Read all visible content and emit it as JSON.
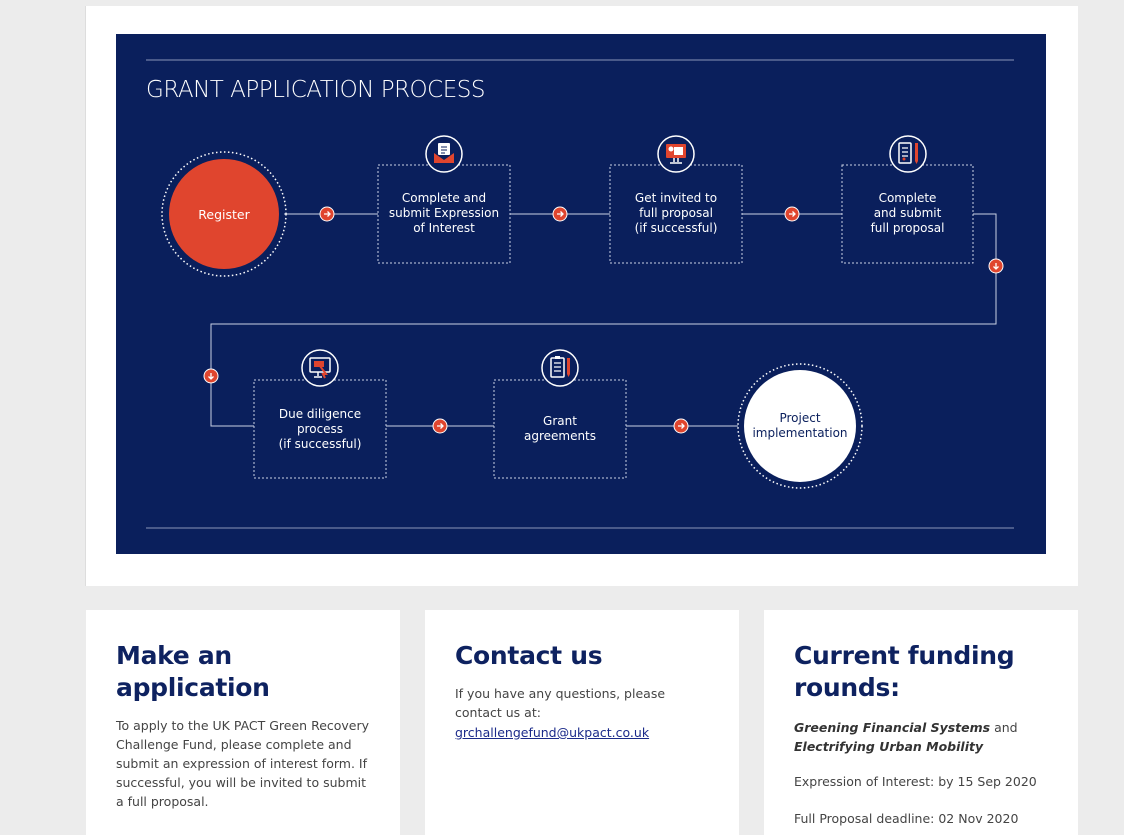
{
  "diagram": {
    "title": "GRANT APPLICATION PROCESS",
    "colors": {
      "background": "#0a1f5c",
      "accent": "#e0452e"
    },
    "steps": {
      "register": "Register",
      "eoi": [
        "Complete and",
        "submit Expression",
        "of Interest"
      ],
      "invited": [
        "Get invited to",
        "full proposal",
        "(if successful)"
      ],
      "full": [
        "Complete",
        "and submit",
        "full proposal"
      ],
      "diligence": [
        "Due diligence",
        "process",
        "(if successful)"
      ],
      "grant": [
        "Grant",
        "agreements"
      ],
      "project": [
        "Project",
        "implementation"
      ]
    }
  },
  "cards": {
    "application": {
      "title": "Make an application",
      "text": "To apply to the UK PACT Green Recovery Challenge Fund, please complete and submit an expression of interest form. If successful, you will be invited to submit a full proposal."
    },
    "contact": {
      "title": "Contact us",
      "text": "If you have any questions, please contact us at:",
      "email": "grchallengefund@ukpact.co.uk"
    },
    "rounds": {
      "title": "Current funding rounds:",
      "round1": "Greening Financial Systems",
      "joiner": "and",
      "round2": "Electrifying Urban Mobility",
      "eoi_deadline": "Expression of Interest: by 15 Sep 2020",
      "full_deadline": "Full Proposal deadline: 02 Nov 2020"
    }
  }
}
